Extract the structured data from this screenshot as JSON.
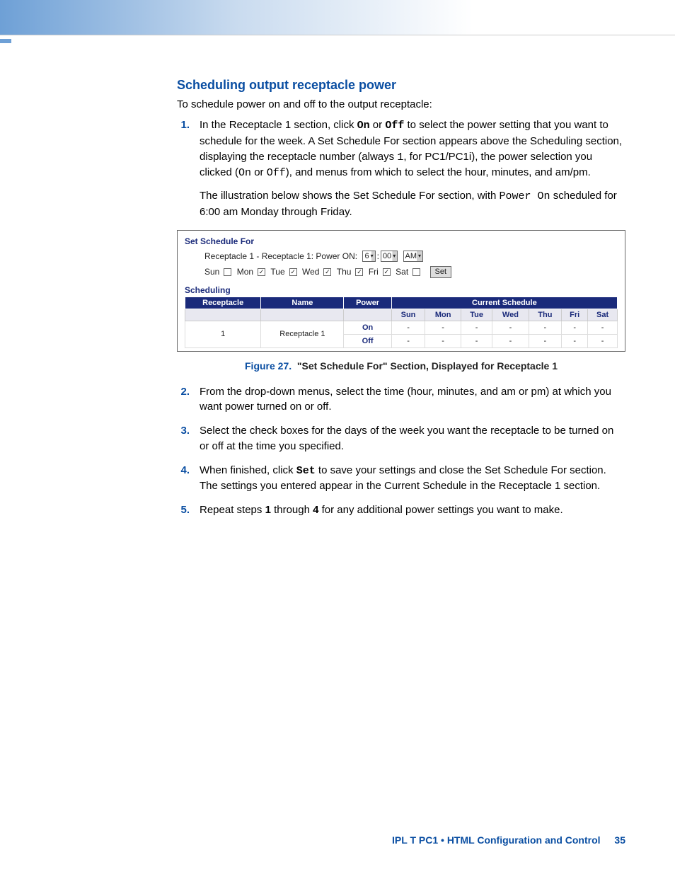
{
  "heading": "Scheduling output receptacle power",
  "intro": "To schedule power on and off to the output receptacle:",
  "steps": [
    {
      "n": "1.",
      "pre": "In the Receptacle 1 section, click ",
      "b1": "On",
      "mid": " or ",
      "b2": "Off",
      "post": " to select the power setting that you want to schedule for the week. A Set Schedule For section appears above the Scheduling section, displaying the receptacle number (always ",
      "m1": "1",
      "post2": ", for PC1/PC1i), the power selection you clicked (",
      "m2": "On",
      "mid2": " or ",
      "m3": "Off",
      "post3": "), and menus from which to select the hour, minutes, and am/pm."
    },
    {
      "extra": "The illustration below shows the Set Schedule For section, with ",
      "m": "Power On",
      "post": " scheduled for 6:00 am Monday through Friday."
    }
  ],
  "fig": {
    "setHdr": "Set Schedule For",
    "line": "Receptacle 1 - Receptacle 1: Power ON:",
    "hour": "6",
    "min": "00",
    "ampm": "AM",
    "days": [
      {
        "lab": "Sun",
        "c": false
      },
      {
        "lab": "Mon",
        "c": true
      },
      {
        "lab": "Tue",
        "c": true
      },
      {
        "lab": "Wed",
        "c": true
      },
      {
        "lab": "Thu",
        "c": true
      },
      {
        "lab": "Fri",
        "c": true
      },
      {
        "lab": "Sat",
        "c": false
      }
    ],
    "setBtn": "Set",
    "schedHdr": "Scheduling",
    "cols": {
      "r": "Receptacle",
      "n": "Name",
      "p": "Power",
      "cs": "Current Schedule"
    },
    "daysHdr": [
      "Sun",
      "Mon",
      "Tue",
      "Wed",
      "Thu",
      "Fri",
      "Sat"
    ],
    "row": {
      "num": "1",
      "name": "Receptacle 1",
      "on": "On",
      "off": "Off",
      "cell": "-"
    }
  },
  "caption": {
    "fig": "Figure 27.",
    "title": "\"Set Schedule For\" Section, Displayed for Receptacle 1"
  },
  "steps2": [
    {
      "n": "2.",
      "t": "From the drop-down menus, select the time (hour, minutes, and am or pm) at which you want power turned on or off."
    },
    {
      "n": "3.",
      "t": "Select the check boxes for the days of the week you want the receptacle to be turned on or off at the time you specified."
    },
    {
      "n": "4.",
      "pre": "When finished, click ",
      "b": "Set",
      "post": " to save your settings and close the Set Schedule For section. The settings you entered appear in the Current Schedule in the Receptacle 1 section."
    },
    {
      "n": "5.",
      "pre": "Repeat steps ",
      "b1": "1",
      "mid": " through ",
      "b2": "4",
      "post": " for any additional power settings you want to make."
    }
  ],
  "footer": {
    "doc": "IPL T PC1 • HTML Configuration and Control",
    "page": "35"
  }
}
